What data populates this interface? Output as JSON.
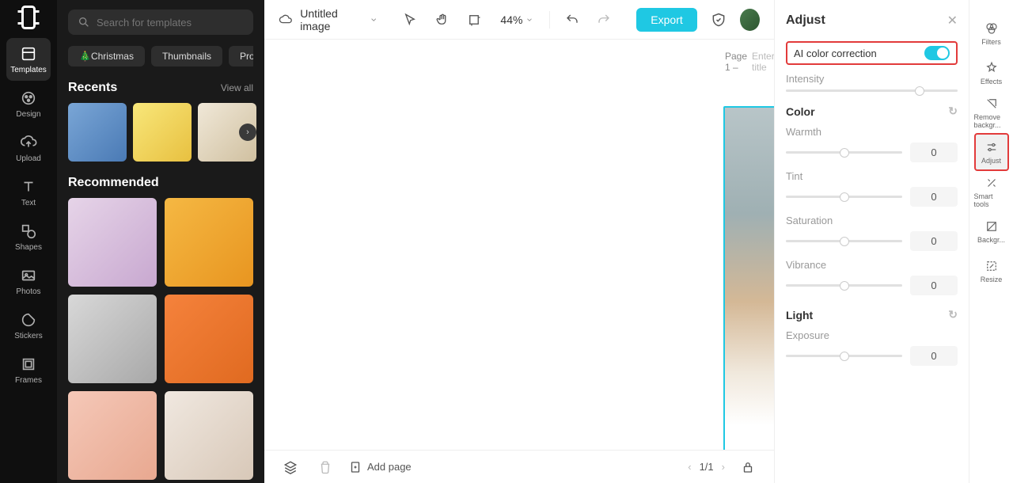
{
  "app": {
    "title": "Untitled image"
  },
  "search": {
    "placeholder": "Search for templates"
  },
  "chips": [
    "🎄Christmas",
    "Thumbnails",
    "Prod"
  ],
  "sidebarLeft": [
    {
      "label": "Templates",
      "active": true
    },
    {
      "label": "Design"
    },
    {
      "label": "Upload"
    },
    {
      "label": "Text"
    },
    {
      "label": "Shapes"
    },
    {
      "label": "Photos"
    },
    {
      "label": "Stickers"
    },
    {
      "label": "Frames"
    }
  ],
  "sections": {
    "recents": {
      "title": "Recents",
      "viewAll": "View all"
    },
    "recommended": {
      "title": "Recommended"
    }
  },
  "toolbar": {
    "zoom": "44%",
    "export": "Export"
  },
  "page": {
    "label": "Page 1 –",
    "placeholder": "Enter title"
  },
  "bottom": {
    "addPage": "Add page",
    "count": "1/1"
  },
  "adjust": {
    "title": "Adjust",
    "ai": "AI color correction",
    "intensity": "Intensity",
    "color": "Color",
    "warmth": "Warmth",
    "tint": "Tint",
    "saturation": "Saturation",
    "vibrance": "Vibrance",
    "light": "Light",
    "exposure": "Exposure",
    "zero": "0"
  },
  "rightTools": [
    {
      "label": "Filters"
    },
    {
      "label": "Effects"
    },
    {
      "label": "Remove backgr..."
    },
    {
      "label": "Adjust",
      "highlight": true,
      "active": true
    },
    {
      "label": "Smart tools"
    },
    {
      "label": "Backgr..."
    },
    {
      "label": "Resize"
    }
  ]
}
